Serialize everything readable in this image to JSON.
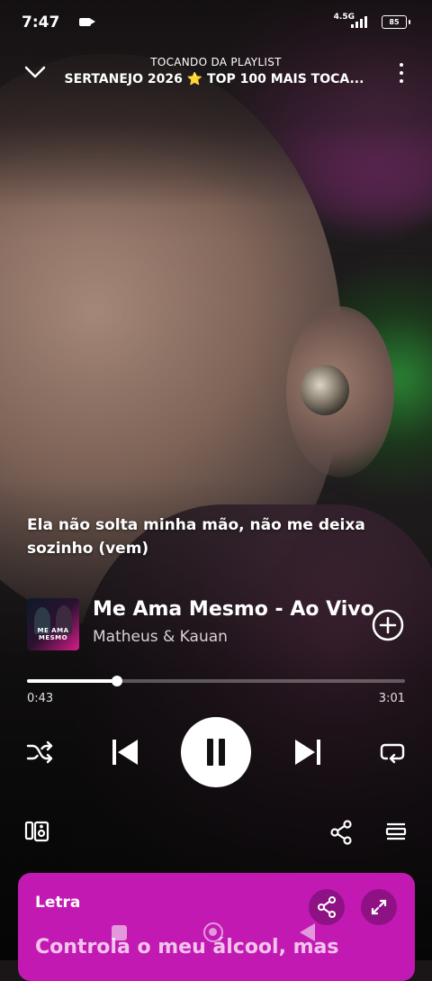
{
  "status_bar": {
    "time": "7:47",
    "network": "4.5G",
    "battery": "85"
  },
  "header": {
    "subtitle": "TOCANDO DA PLAYLIST",
    "playlist_title": "SERTANEJO 2026 ⭐ TOP 100 MAIS TOCA..."
  },
  "current_lyric": "Ela não solta minha mão, não me deixa sozinho (vem)",
  "track": {
    "title": "Me Ama Mesmo - Ao Vivo",
    "artist": "Matheus & Kauan",
    "cover_text": "ME AMA MESMO"
  },
  "progress": {
    "elapsed": "0:43",
    "total": "3:01",
    "fraction": 0.238
  },
  "lyrics_card": {
    "label": "Letra",
    "preview": "Controla o meu álcool, mas"
  },
  "colors": {
    "accent": "#c219b3",
    "accent_dark": "#8e1284"
  },
  "icons": [
    "chevron-down-icon",
    "more-vert-icon",
    "add-circle-icon",
    "shuffle-icon",
    "skip-previous-icon",
    "pause-icon",
    "skip-next-icon",
    "repeat-icon",
    "connect-device-icon",
    "share-icon",
    "queue-icon",
    "expand-icon"
  ]
}
